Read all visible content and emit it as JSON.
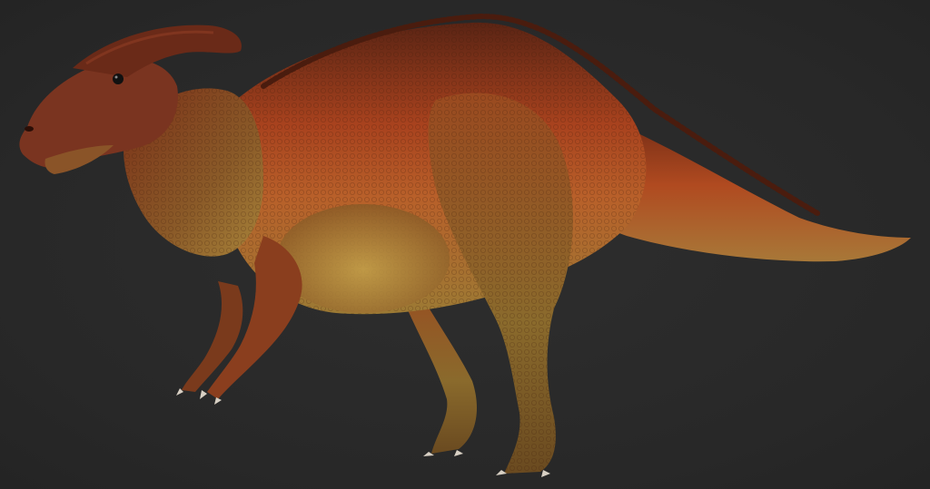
{
  "scene": {
    "subject": "dinosaur-render",
    "background_color": "#2a2a2a",
    "palette": {
      "body_dark": "#5a2414",
      "body_mid": "#9a3a1c",
      "body_orange": "#c85a24",
      "belly": "#a8843a",
      "belly_light": "#c4a04a",
      "crest": "#6a2a18",
      "claw": "#d8d0c4",
      "eye": "#111111"
    }
  }
}
